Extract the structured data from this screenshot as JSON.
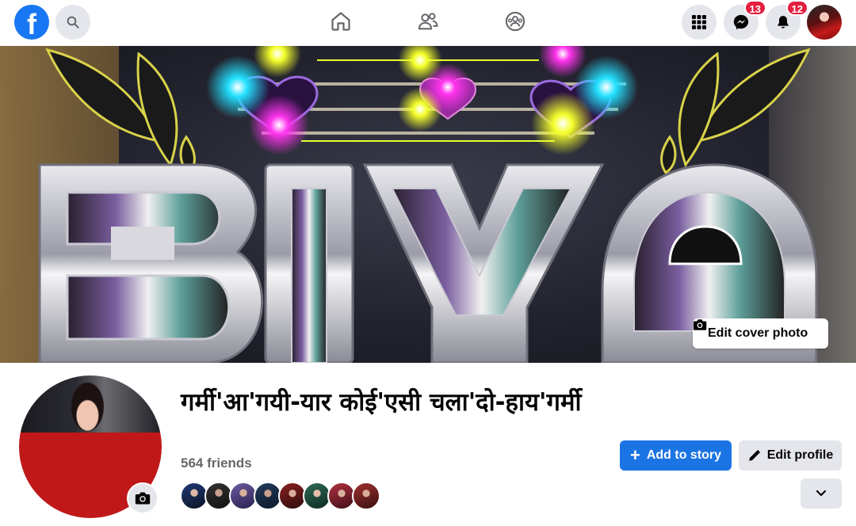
{
  "topbar": {
    "logo_letter": "f",
    "logo_icon": "facebook-logo-icon",
    "search_icon": "search-icon",
    "nav": [
      {
        "icon": "home-icon"
      },
      {
        "icon": "friends-icon"
      },
      {
        "icon": "groups-icon"
      }
    ],
    "menu_icon": "grid-menu-icon",
    "messenger_icon": "messenger-icon",
    "messenger_badge": "13",
    "notifications_icon": "bell-icon",
    "notifications_badge": "12",
    "avatar_icon": "account-avatar"
  },
  "cover": {
    "edit_label": "Edit cover photo",
    "edit_icon": "camera-icon"
  },
  "profile": {
    "name": "गर्मी'आ'गयी-यार कोई'एसी चला'दो-हाय'गर्मी",
    "friends_count": "564 friends",
    "friend_avatar_count": 8,
    "camera_icon": "camera-icon"
  },
  "actions": {
    "add_story_label": "Add to story",
    "add_story_icon": "plus-icon",
    "edit_profile_label": "Edit profile",
    "edit_profile_icon": "pencil-icon",
    "more_icon": "chevron-down-icon"
  },
  "colors": {
    "brand": "#1877f2",
    "primary_button": "#1b74e4",
    "badge": "#e41e3f",
    "secondary_button": "#e4e6eb",
    "muted_text": "#65676b"
  }
}
